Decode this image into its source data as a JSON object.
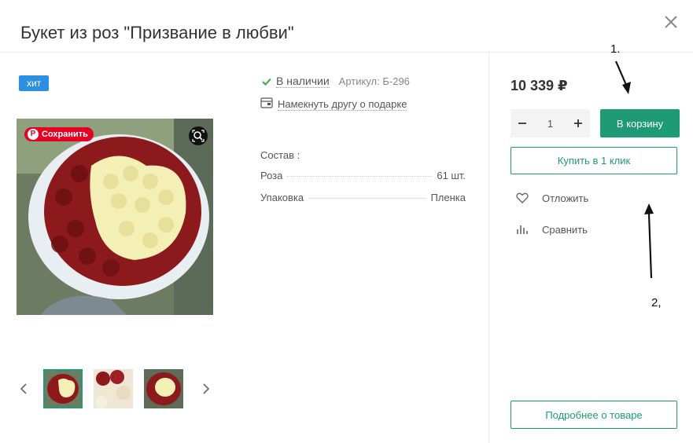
{
  "product": {
    "title": "Букет из роз \"Призвание в любви\"",
    "badge": "хит",
    "stock": "В наличии",
    "sku": "Артикул: Б-296",
    "gift_hint": "Намекнуть другу о подарке",
    "pinterest_label": "Сохранить",
    "composition_title": "Состав :",
    "composition": [
      {
        "name": "Роза",
        "value": "61 шт."
      },
      {
        "name": "Упаковка",
        "value": "Пленка"
      }
    ],
    "thumbnail_count": 3,
    "selected_thumbnail": 1
  },
  "buy": {
    "price": "10 339 ₽",
    "quantity": "1",
    "cart_label": "В корзину",
    "one_click_label": "Купить в 1 клик",
    "wishlist_label": "Отложить",
    "compare_label": "Сравнить",
    "details_label": "Подробнее о товаре"
  },
  "annotations": {
    "label_1": "1.",
    "label_2": "2,"
  },
  "colors": {
    "accent": "#1e9b74",
    "badge": "#2d8fe0",
    "pinterest": "#e60023",
    "stock_check": "#3aa843"
  },
  "icons": [
    "close-icon",
    "check-icon",
    "gift-icon",
    "pinterest-icon",
    "zoom-icon",
    "chevron-left-icon",
    "chevron-right-icon",
    "minus-icon",
    "plus-icon",
    "heart-icon",
    "bar-chart-icon"
  ]
}
